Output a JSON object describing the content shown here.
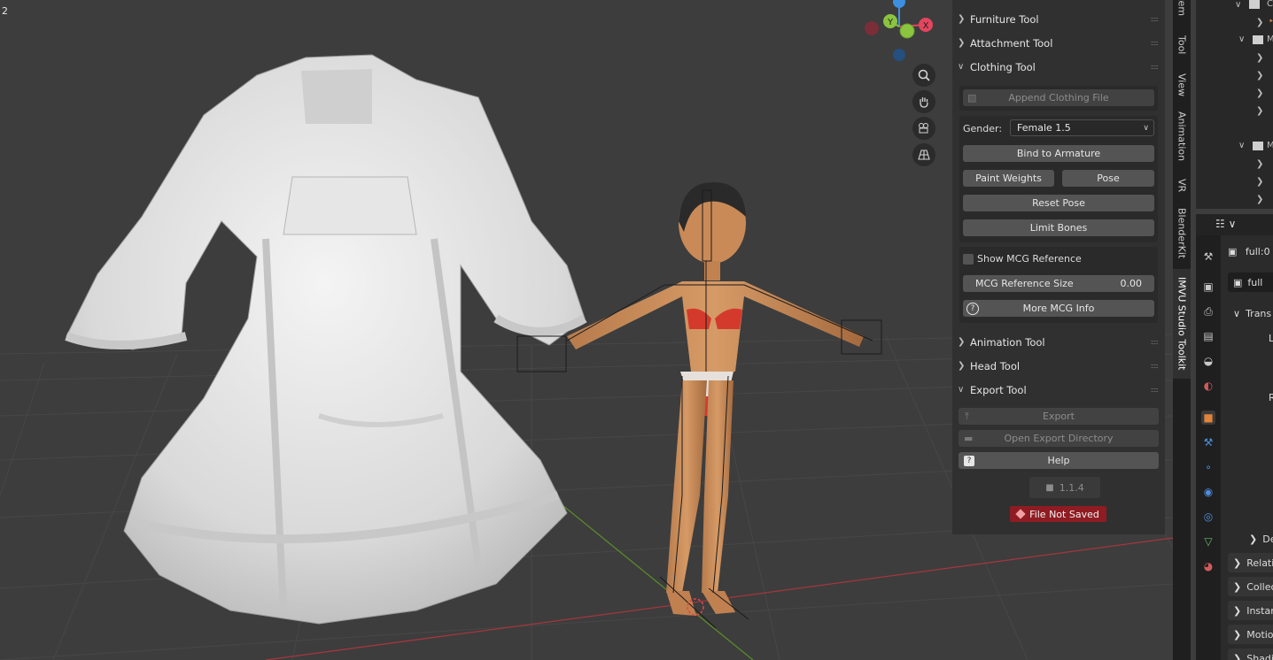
{
  "viewport": {
    "frame_label": "2",
    "gizmo": {
      "x_label": "X",
      "y_label": "Y",
      "z_label": ""
    }
  },
  "nav_tools": [
    {
      "icon": "zoom-icon"
    },
    {
      "icon": "hand-pan-icon"
    },
    {
      "icon": "camera-icon"
    },
    {
      "icon": "perspective-grid-icon"
    }
  ],
  "npanel": {
    "furniture_tool": "Furniture Tool",
    "attachment_tool": "Attachment Tool",
    "clothing_tool": "Clothing Tool",
    "append_clothing_file": "Append Clothing File",
    "gender_label": "Gender:",
    "gender_value": "Female 1.5",
    "bind_to_armature": "Bind to Armature",
    "paint_weights": "Paint Weights",
    "pose": "Pose",
    "reset_pose": "Reset Pose",
    "limit_bones": "Limit Bones",
    "show_mcg_reference": "Show MCG Reference",
    "mcg_reference_size_label": "MCG Reference Size",
    "mcg_reference_size_value": "0.00",
    "more_mcg_info": "More MCG Info",
    "animation_tool": "Animation Tool",
    "head_tool": "Head Tool",
    "export_tool": "Export Tool",
    "export": "Export",
    "open_export_directory": "Open Export Directory",
    "help": "Help",
    "version": "1.1.4",
    "file_not_saved": "File Not Saved"
  },
  "sidebar_tabs": {
    "item": "Item",
    "tool": "Tool",
    "view": "View",
    "animation": "Animation",
    "vr": "VR",
    "blenderkit": "BlenderKit",
    "imvu": "IMVU Studio Toolkit"
  },
  "outliner": {
    "rows": [
      "C",
      "",
      "M",
      "",
      "",
      "",
      "",
      "M",
      "",
      "",
      ""
    ]
  },
  "properties": {
    "object_name": "full:0",
    "datablock_name": "full",
    "sections": [
      "Trans",
      "L",
      "R",
      "Del",
      "Relatio",
      "Collec",
      "Instan",
      "Motio",
      "Shadi"
    ]
  },
  "colors": {
    "accent_orange": "#e0843a",
    "unsaved_red": "#8f1c22",
    "axis_x": "#e5455e",
    "axis_y": "#8bc43f",
    "axis_z": "#3d8fe0"
  }
}
